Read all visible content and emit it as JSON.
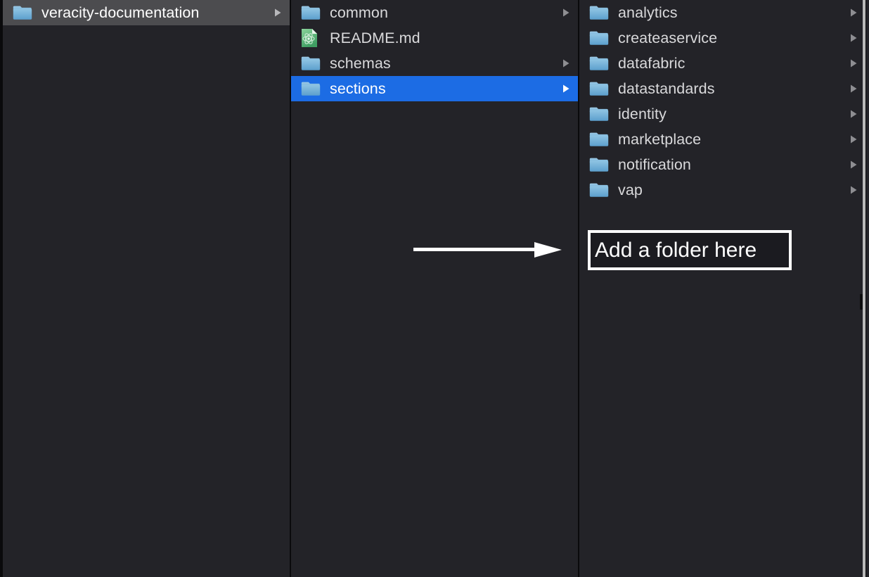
{
  "window": {
    "view": "column-view",
    "background_color": "#232328",
    "divider_color": "#0a0a0c",
    "selection_active_color": "#1c6ce4",
    "selection_inactive_color": "#4c4c4f",
    "text_color": "#d9d9db",
    "annotation_color": "#ffffff"
  },
  "columns": [
    {
      "name": "column-root",
      "items": [
        {
          "label": "veracity-documentation",
          "icon": "folder-icon",
          "kind": "folder",
          "has_chevron": true,
          "state": "selected-inactive"
        }
      ]
    },
    {
      "name": "column-veracity-documentation",
      "items": [
        {
          "label": "common",
          "icon": "folder-icon",
          "kind": "folder",
          "has_chevron": true,
          "state": "normal"
        },
        {
          "label": "README.md",
          "icon": "atom-file-icon",
          "kind": "file",
          "has_chevron": false,
          "state": "normal"
        },
        {
          "label": "schemas",
          "icon": "folder-icon",
          "kind": "folder",
          "has_chevron": true,
          "state": "normal"
        },
        {
          "label": "sections",
          "icon": "folder-icon",
          "kind": "folder",
          "has_chevron": true,
          "state": "selected-active"
        }
      ]
    },
    {
      "name": "column-sections",
      "items": [
        {
          "label": "analytics",
          "icon": "folder-icon",
          "kind": "folder",
          "has_chevron": true,
          "state": "normal"
        },
        {
          "label": "createaservice",
          "icon": "folder-icon",
          "kind": "folder",
          "has_chevron": true,
          "state": "normal"
        },
        {
          "label": "datafabric",
          "icon": "folder-icon",
          "kind": "folder",
          "has_chevron": true,
          "state": "normal"
        },
        {
          "label": "datastandards",
          "icon": "folder-icon",
          "kind": "folder",
          "has_chevron": true,
          "state": "normal"
        },
        {
          "label": "identity",
          "icon": "folder-icon",
          "kind": "folder",
          "has_chevron": true,
          "state": "normal"
        },
        {
          "label": "marketplace",
          "icon": "folder-icon",
          "kind": "folder",
          "has_chevron": true,
          "state": "normal"
        },
        {
          "label": "notification",
          "icon": "folder-icon",
          "kind": "folder",
          "has_chevron": true,
          "state": "normal"
        },
        {
          "label": "vap",
          "icon": "folder-icon",
          "kind": "folder",
          "has_chevron": true,
          "state": "normal"
        }
      ]
    }
  ],
  "annotation": {
    "arrow": {
      "name": "arrow-right-annotation",
      "direction": "right"
    },
    "callout": {
      "text": "Add a folder here"
    }
  }
}
